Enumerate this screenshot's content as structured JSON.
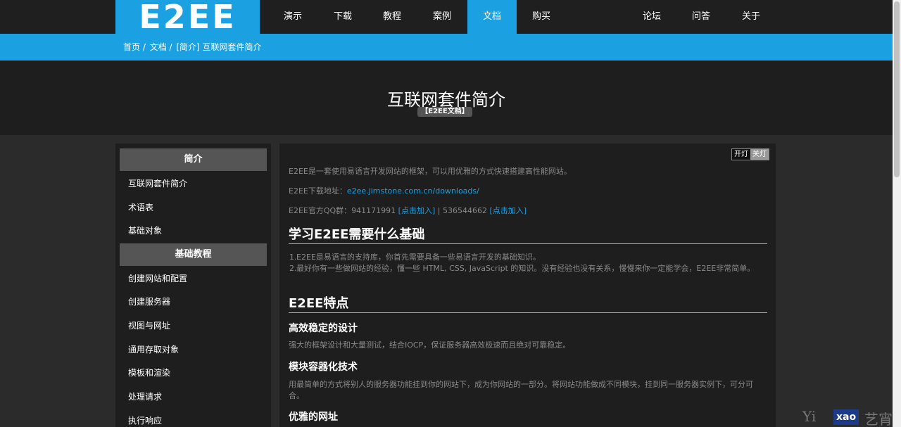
{
  "logo": "E2EE",
  "nav": {
    "items": [
      "演示",
      "下载",
      "教程",
      "案例",
      "文档",
      "购买",
      "论坛",
      "问答",
      "关于"
    ],
    "active": "文档"
  },
  "breadcrumb": [
    "首页 /",
    "文档 /",
    "[简介] 互联网套件简介"
  ],
  "hero": {
    "title": "互联网套件简介",
    "badge": "【E2EE文档】"
  },
  "sidebar": {
    "sections": [
      {
        "heading": "简介",
        "items": [
          "互联网套件简介",
          "术语表",
          "基础对象"
        ]
      },
      {
        "heading": "基础教程",
        "items": [
          "创建网站和配置",
          "创建服务器",
          "视图与网址",
          "通用存取对象",
          "模板和渲染",
          "处理请求",
          "执行响应"
        ]
      }
    ]
  },
  "toggle": {
    "on": "开灯",
    "off": "关灯"
  },
  "content": {
    "intro": "E2EE是一套使用易语言开发网站的框架，可以用优雅的方式快速搭建高性能网站。",
    "download_label": "E2EE下载地址：",
    "download_link": "e2ee.jimstone.com.cn/downloads/",
    "qq_prefix": "E2EE官方QQ群：941171991 ",
    "qq_join1": "[点击加入]",
    "qq_mid": " | 536544662 ",
    "qq_join2": "[点击加入]",
    "h_basics": "学习E2EE需要什么基础",
    "basics": [
      "E2EE是易语言的支持库，你首先需要具备一些易语言开发的基础知识。",
      "最好你有一些做网站的经验，懂一些 HTML, CSS, JavaScript 的知识。没有经验也没有关系，慢慢来你一定能学会，E2EE非常简单。"
    ],
    "h_features": "E2EE特点",
    "features": [
      {
        "title": "高效稳定的设计",
        "desc": "强大的框架设计和大量测试，结合IOCP，保证服务器高效极速而且绝对可靠稳定。"
      },
      {
        "title": "模块容器化技术",
        "desc": "用最简单的方式将别人的服务器功能挂到你的网站下，成为你网站的一部分。将网站功能做成不同模块，挂到同一服务器实例下，可分可合。"
      },
      {
        "title": "优雅的网址",
        "desc": ""
      }
    ]
  },
  "watermark": {
    "a": "Yi",
    "b": "xao",
    "c": "艺宵"
  }
}
